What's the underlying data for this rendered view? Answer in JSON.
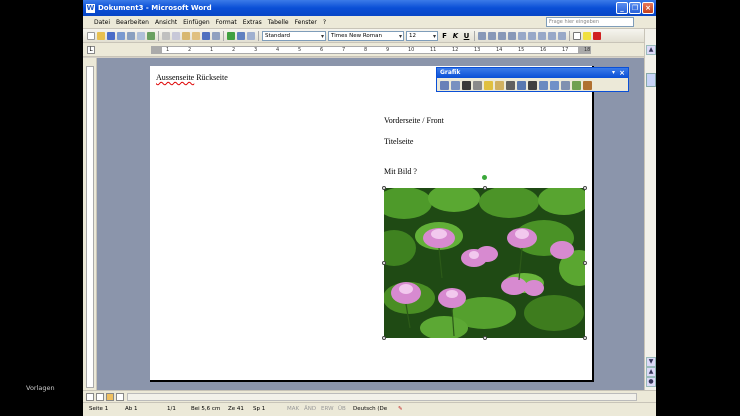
{
  "window": {
    "title": "Dokument3 - Microsoft Word",
    "icon_letter": "W"
  },
  "menu": [
    "Datei",
    "Bearbeiten",
    "Ansicht",
    "Einfügen",
    "Format",
    "Extras",
    "Tabelle",
    "Fenster",
    "?"
  ],
  "help_placeholder": "Frage hier eingeben",
  "toolbar": {
    "style": "Standard",
    "font": "Times New Roman",
    "size": "12",
    "bold": "F",
    "italic": "K",
    "underline": "U"
  },
  "ruler_numbers": [
    "1",
    "2",
    "1",
    "2",
    "3",
    "4",
    "5",
    "6",
    "7",
    "8",
    "9",
    "10",
    "11",
    "12",
    "13",
    "14",
    "15",
    "16",
    "17",
    "18"
  ],
  "document": {
    "line1_underlined": "Aussenseite",
    "line1_rest": " Rückseite",
    "front_label": "Vorderseite / Front",
    "title_label": "Titelseite",
    "image_label": "Mit Bild ?"
  },
  "grafik_toolbar": {
    "title": "Grafik",
    "close": "×",
    "dropdown": "▾"
  },
  "status": {
    "page": "Seite 1",
    "section": "Ab 1",
    "pages": "1/1",
    "position": "Bei 5,6 cm",
    "line": "Ze 41",
    "column": "Sp 1",
    "mak": "MAK",
    "aend": "ÄND",
    "erw": "ERW",
    "ub": "ÜB",
    "language": "Deutsch (De"
  },
  "desktop_label": "Vorlagen",
  "colors": {
    "title_blue": "#0a4fd6",
    "menu_bg": "#ece9d8",
    "workspace": "#8b95ab"
  }
}
